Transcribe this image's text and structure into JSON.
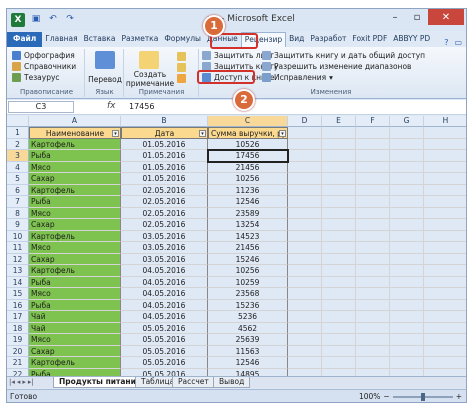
{
  "window": {
    "title": "ки - Microsoft Excel"
  },
  "qat": {
    "undo": "↶",
    "redo": "↷",
    "save": "▣",
    "logo": "X"
  },
  "ribbon_tabs": [
    "Файл",
    "Главная",
    "Вставка",
    "Разметка",
    "Формулы",
    "Данные",
    "Рецензир",
    "Вид",
    "Разработ",
    "Foxit PDF",
    "ABBYY PD"
  ],
  "ribbon": {
    "spelling": "Орфография",
    "references": "Справочники",
    "thesaurus": "Тезаурус",
    "group_proofing": "Правописание",
    "translate": "Перевод",
    "group_language": "Язык",
    "new_comment_line1": "Создать",
    "new_comment_line2": "примечание",
    "group_comments": "Примечания",
    "protect_sheet": "Защитить лист",
    "protect_book": "Защитить книгу",
    "share_book": "Доступ к книге",
    "protect_share": "Защитить книгу и дать общий доступ",
    "allow_ranges": "Разрешить изменение диапазонов",
    "track_changes": "Исправления",
    "group_changes": "Изменения"
  },
  "formula_bar": {
    "cell_ref": "C3",
    "fx": "fx",
    "value": "17456"
  },
  "columns": [
    "A",
    "B",
    "C",
    "D",
    "E",
    "F",
    "G",
    "H"
  ],
  "table": {
    "headers": [
      "Наименование",
      "Дата",
      "Сумма выручки, ру"
    ],
    "rows": [
      [
        "Картофель",
        "01.05.2016",
        "10526"
      ],
      [
        "Рыба",
        "01.05.2016",
        "17456"
      ],
      [
        "Мясо",
        "01.05.2016",
        "21456"
      ],
      [
        "Сахар",
        "01.05.2016",
        "10256"
      ],
      [
        "Картофель",
        "02.05.2016",
        "11236"
      ],
      [
        "Рыба",
        "02.05.2016",
        "12546"
      ],
      [
        "Мясо",
        "02.05.2016",
        "23589"
      ],
      [
        "Сахар",
        "02.05.2016",
        "13254"
      ],
      [
        "Картофель",
        "03.05.2016",
        "14523"
      ],
      [
        "Мясо",
        "03.05.2016",
        "21456"
      ],
      [
        "Сахар",
        "03.05.2016",
        "15246"
      ],
      [
        "Картофель",
        "04.05.2016",
        "10256"
      ],
      [
        "Рыба",
        "04.05.2016",
        "10259"
      ],
      [
        "Мясо",
        "04.05.2016",
        "23568"
      ],
      [
        "Рыба",
        "04.05.2016",
        "15236"
      ],
      [
        "Чай",
        "04.05.2016",
        "5236"
      ],
      [
        "Чай",
        "05.05.2016",
        "4562"
      ],
      [
        "Мясо",
        "05.05.2016",
        "25639"
      ],
      [
        "Сахар",
        "05.05.2016",
        "11563"
      ],
      [
        "Картофель",
        "05.05.2016",
        "12546"
      ],
      [
        "Рыба",
        "05.05.2016",
        "14895"
      ]
    ]
  },
  "sheet_tabs": [
    "Продукты питания",
    "Таблица",
    "Рассчет",
    "Вывод"
  ],
  "status": {
    "ready": "Готово",
    "zoom": "100%"
  },
  "markers": [
    "1",
    "2"
  ],
  "colors": {
    "green": "#7ec24f",
    "header": "#fbd98f",
    "marker": "#d96a3a",
    "highlight": "#d3312b"
  }
}
